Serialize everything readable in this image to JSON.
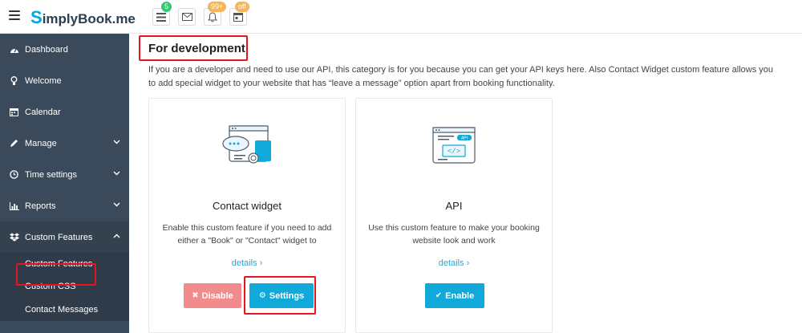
{
  "brand": {
    "logo_s": "S",
    "logo_rest": "implyBook",
    "logo_suffix": ".me"
  },
  "topbar": {
    "icons": [
      {
        "name": "list-icon",
        "badge": "5",
        "badge_color": "#2ecc71"
      },
      {
        "name": "envelope-icon",
        "badge": "",
        "badge_color": ""
      },
      {
        "name": "bell-icon",
        "badge": "99+",
        "badge_color": "#f5b55a"
      },
      {
        "name": "calendar-card-icon",
        "badge": "off",
        "badge_color": "#f5b55a"
      }
    ]
  },
  "sidebar": {
    "items": [
      {
        "label": "Dashboard",
        "icon": "dashboard-icon"
      },
      {
        "label": "Welcome",
        "icon": "lightbulb-icon"
      },
      {
        "label": "Calendar",
        "icon": "calendar-icon"
      },
      {
        "label": "Manage",
        "icon": "pencil-icon",
        "expandable": true
      },
      {
        "label": "Time settings",
        "icon": "clock-icon",
        "expandable": true
      },
      {
        "label": "Reports",
        "icon": "bar-chart-icon",
        "expandable": true
      },
      {
        "label": "Custom Features",
        "icon": "dropbox-icon",
        "expandable": true,
        "open": true
      }
    ],
    "sub_items": [
      {
        "label": "Custom Features",
        "active": true
      },
      {
        "label": "Custom CSS"
      },
      {
        "label": "Contact Messages"
      }
    ]
  },
  "main": {
    "section_title": "For development",
    "section_desc": "If you are a developer and need to use our API, this category is for you because you can get your API keys here. Also Contact Widget custom feature allows you to add special widget to your website that has “leave a message” option apart from booking functionality.",
    "cards": [
      {
        "title": "Contact widget",
        "description": "Enable this custom feature if you need to add either a \"Book\" or \"Contact\" widget to",
        "details_label": "details",
        "disable_label": "Disable",
        "settings_label": "Settings"
      },
      {
        "title": "API",
        "description": "Use this custom feature to make your booking website look and work",
        "details_label": "details",
        "enable_label": "Enable",
        "illustration_text": "API"
      }
    ]
  },
  "colors": {
    "sidebar_bg": "#3b4a5a",
    "accent": "#11a9d9",
    "danger_light": "#f28b8b",
    "highlight": "#e5141e"
  }
}
